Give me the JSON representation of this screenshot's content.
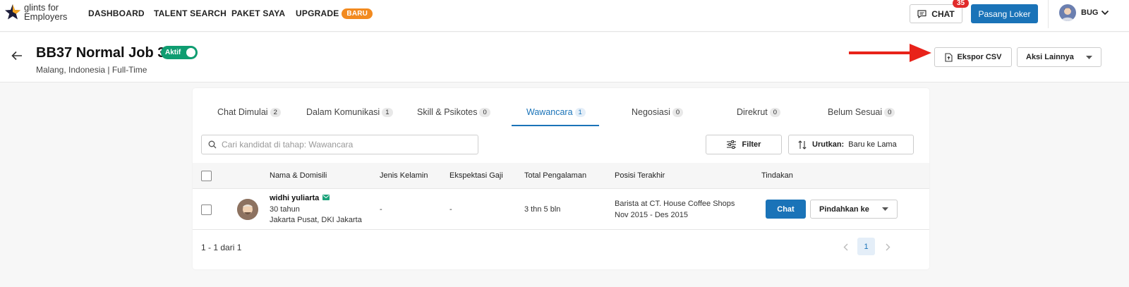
{
  "brand": {
    "line1": "glints for",
    "line2": "Employers"
  },
  "nav": {
    "items": [
      {
        "label": "DASHBOARD"
      },
      {
        "label": "TALENT SEARCH"
      },
      {
        "label": "PAKET SAYA"
      },
      {
        "label": "UPGRADE",
        "badge": "BARU"
      }
    ],
    "chat_label": "CHAT",
    "chat_count": "35",
    "post_job_label": "Pasang Loker",
    "user_name": "BUG"
  },
  "job": {
    "title": "BB37 Normal Job 3",
    "status_label": "Aktif",
    "subtitle": "Malang, Indonesia | Full-Time",
    "export_label": "Ekspor CSV",
    "more_actions_label": "Aksi Lainnya"
  },
  "tabs": [
    {
      "label": "Chat Dimulai",
      "count": "2"
    },
    {
      "label": "Dalam Komunikasi",
      "count": "1"
    },
    {
      "label": "Skill & Psikotes",
      "count": "0"
    },
    {
      "label": "Wawancara",
      "count": "1",
      "active": true
    },
    {
      "label": "Negosiasi",
      "count": "0"
    },
    {
      "label": "Direkrut",
      "count": "0"
    },
    {
      "label": "Belum Sesuai",
      "count": "0"
    }
  ],
  "toolbar": {
    "search_placeholder": "Cari kandidat di tahap: Wawancara",
    "filter_label": "Filter",
    "sort_label": "Urutkan:",
    "sort_value": "Baru ke Lama"
  },
  "table": {
    "headers": {
      "name": "Nama & Domisili",
      "gender": "Jenis Kelamin",
      "salary": "Ekspektasi Gaji",
      "experience": "Total Pengalaman",
      "last_position": "Posisi Terakhir",
      "actions": "Tindakan"
    },
    "rows": [
      {
        "name": "widhi yuliarta",
        "age": "30 tahun",
        "location": "Jakarta Pusat, DKI Jakarta",
        "gender": "-",
        "salary": "-",
        "experience": "3 thn 5 bln",
        "position": "Barista at CT. House Coffee Shops",
        "period": "Nov 2015 - Des 2015",
        "chat_label": "Chat",
        "move_label": "Pindahkan ke"
      }
    ]
  },
  "pagination": {
    "summary": "1 - 1 dari 1",
    "current_page": "1"
  },
  "colors": {
    "primary": "#1a73b8",
    "active_status": "#0f9d71",
    "badge_orange": "#f28a1f",
    "alert_red": "#e12b2b"
  }
}
